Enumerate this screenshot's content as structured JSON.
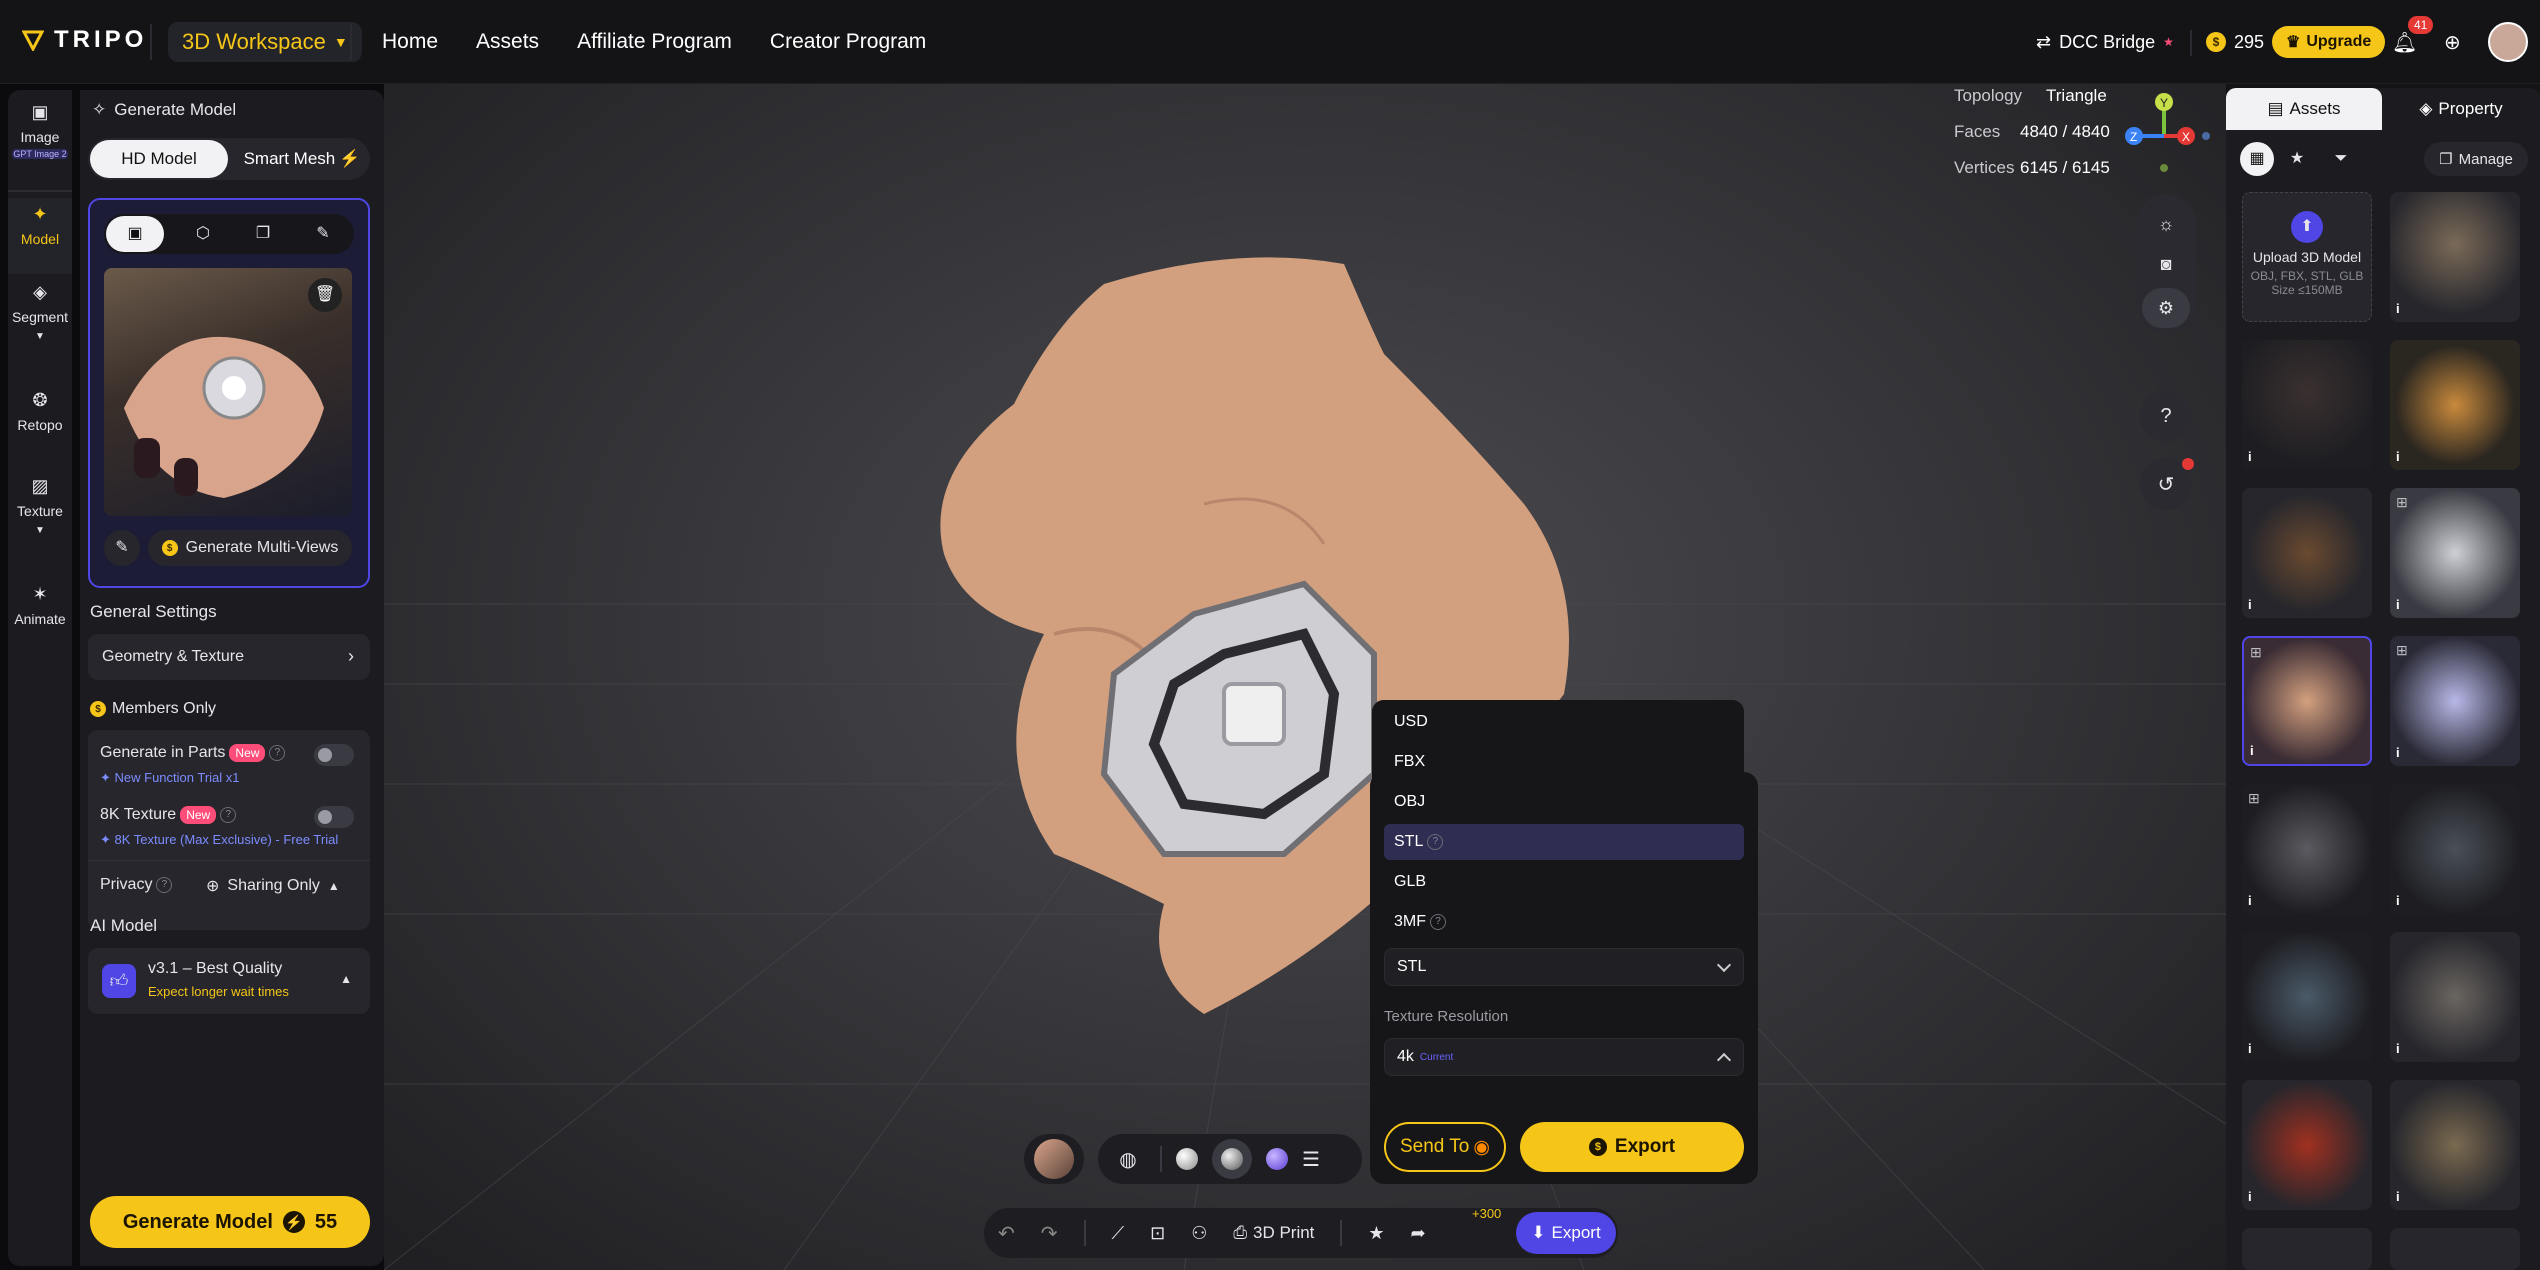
{
  "topbar": {
    "logo": "TRIPO",
    "workspace": "3D Workspace",
    "nav": [
      "Home",
      "Assets",
      "Affiliate Program",
      "Creator Program"
    ],
    "dcc_bridge": "DCC Bridge",
    "credits": "295",
    "upgrade": "Upgrade",
    "notifications": "41"
  },
  "rail": {
    "image": "Image",
    "image_badge": "GPT Image 2",
    "model": "Model",
    "segment": "Segment",
    "retopo": "Retopo",
    "texture": "Texture",
    "animate": "Animate"
  },
  "panel": {
    "title": "Generate Model",
    "tabs": [
      "HD Model",
      "Smart Mesh"
    ],
    "multi_views": "Generate Multi-Views",
    "general_settings": "General Settings",
    "geometry_texture": "Geometry & Texture",
    "members_only": "Members Only",
    "gen_parts": "Generate in Parts",
    "new": "New",
    "gen_parts_sub": "New Function Trial x1",
    "tex8k": "8K Texture",
    "tex8k_sub": "8K Texture (Max Exclusive) - Free Trial",
    "privacy": "Privacy",
    "sharing": "Sharing Only",
    "ai_model": "AI Model",
    "model_name": "v3.1 – Best Quality",
    "model_sub": "Expect longer wait times",
    "generate": "Generate Model",
    "generate_cost": "55"
  },
  "viewport": {
    "topology_label": "Topology",
    "topology_value": "Triangle",
    "faces_label": "Faces",
    "faces_value": "4840 / 4840",
    "vertices_label": "Vertices",
    "vertices_value": "6145 / 6145",
    "help": "?",
    "axis": {
      "y": "Y",
      "x": "X",
      "z": "Z"
    }
  },
  "export_menu": {
    "formats": [
      "USD",
      "FBX",
      "OBJ",
      "STL",
      "GLB",
      "3MF"
    ],
    "selected_format": "STL",
    "texture_resolution_label": "Texture Resolution",
    "texture_resolution": "4k",
    "texture_resolution_note": "Current",
    "send_to": "Send To",
    "export": "Export"
  },
  "bottom_toolbar": {
    "print": "3D Print",
    "plus": "+300",
    "export": "Export"
  },
  "sidepanel": {
    "tabs": [
      "Assets",
      "Property"
    ],
    "manage": "Manage",
    "upload_title": "Upload 3D Model",
    "upload_formats": "OBJ, FBX, STL, GLB",
    "upload_size": "Size ≤150MB",
    "info": "i"
  },
  "colors": {
    "accent": "#f5c518",
    "purple": "#4f46e5",
    "panel": "#1b1b20"
  }
}
